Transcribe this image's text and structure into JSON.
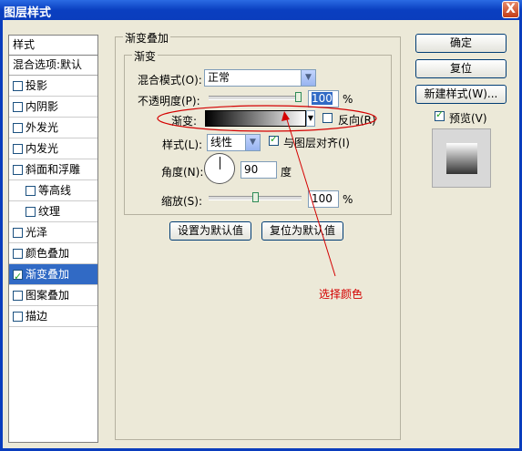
{
  "window": {
    "title": "图层样式",
    "close": "X"
  },
  "sidebar": {
    "header": "样式",
    "blend_options": "混合选项:默认",
    "items": [
      {
        "label": "投影",
        "checked": false,
        "indent": false
      },
      {
        "label": "内阴影",
        "checked": false,
        "indent": false
      },
      {
        "label": "外发光",
        "checked": false,
        "indent": false
      },
      {
        "label": "内发光",
        "checked": false,
        "indent": false
      },
      {
        "label": "斜面和浮雕",
        "checked": false,
        "indent": false
      },
      {
        "label": "等高线",
        "checked": false,
        "indent": true
      },
      {
        "label": "纹理",
        "checked": false,
        "indent": true
      },
      {
        "label": "光泽",
        "checked": false,
        "indent": false
      },
      {
        "label": "颜色叠加",
        "checked": false,
        "indent": false
      },
      {
        "label": "渐变叠加",
        "checked": true,
        "indent": false,
        "selected": true
      },
      {
        "label": "图案叠加",
        "checked": false,
        "indent": false
      },
      {
        "label": "描边",
        "checked": false,
        "indent": false
      }
    ]
  },
  "panel": {
    "outer_legend": "渐变叠加",
    "inner_legend": "渐变",
    "blend_mode_label": "混合模式(O):",
    "blend_mode_value": "正常",
    "opacity_label": "不透明度(P):",
    "opacity_value": "100",
    "opacity_unit": "%",
    "opacity_level": 1.0,
    "gradient_label": "渐变:",
    "reverse_label": "反向(R)",
    "style_label": "样式(L):",
    "style_value": "线性",
    "align_label": "与图层对齐(I)",
    "angle_label": "角度(N):",
    "angle_value": "90",
    "angle_unit": "度",
    "scale_label": "缩放(S):",
    "scale_value": "100",
    "scale_unit": "%",
    "scale_level": 0.5,
    "set_default": "设置为默认值",
    "reset_default": "复位为默认值"
  },
  "buttons": {
    "ok": "确定",
    "reset": "复位",
    "new_style": "新建样式(W)...",
    "preview": "预览(V)"
  },
  "annotation": {
    "text": "选择颜色",
    "color": "#d40000"
  }
}
